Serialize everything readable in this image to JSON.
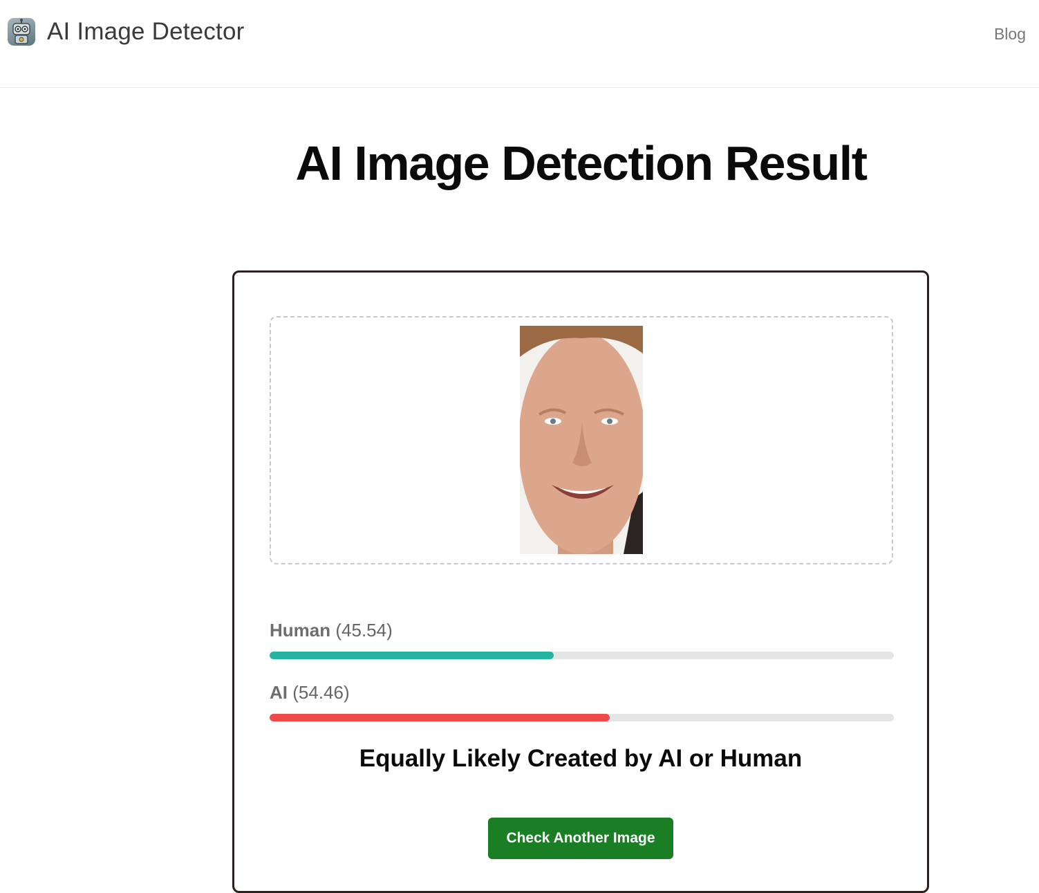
{
  "header": {
    "brand": "AI Image Detector",
    "logo_icon": "robot-icon",
    "nav": {
      "blog_label": "Blog"
    }
  },
  "page": {
    "title": "AI Image Detection Result"
  },
  "result": {
    "image_icon": "uploaded-face-photo",
    "human": {
      "label": "Human",
      "score_text": "(45.54)",
      "score": 45.54,
      "color": "#24b3a0"
    },
    "ai": {
      "label": "AI",
      "score_text": "(54.46)",
      "score": 54.46,
      "color": "#ef4949"
    },
    "verdict": "Equally Likely Created by AI or Human",
    "check_again_label": "Check Another Image",
    "button_color": "#1a7f24"
  }
}
